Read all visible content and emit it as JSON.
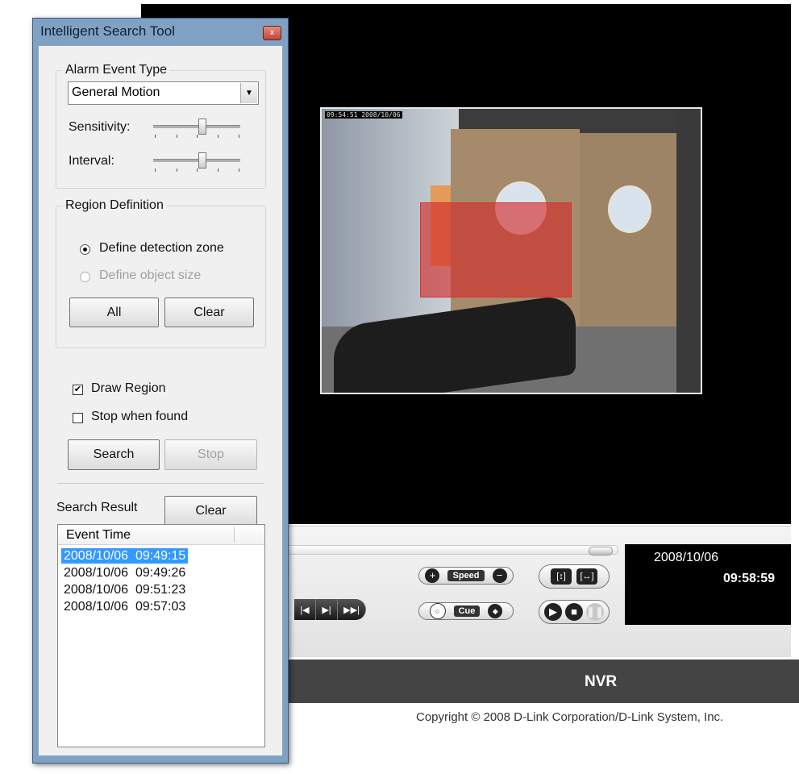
{
  "app": {
    "product_title": "NVR",
    "copyright": "Copyright © 2008 D-Link Corporation/D-Link System, Inc."
  },
  "video": {
    "timestamp": "09:54:51 2008/10/06"
  },
  "playback": {
    "speed_label": "Speed",
    "cue_label": "Cue",
    "date": "2008/10/06",
    "time": "09:58:59"
  },
  "dialog": {
    "title": "Intelligent Search Tool",
    "close_glyph": "x",
    "alarm_group": {
      "legend": "Alarm Event Type",
      "selected_type": "General Motion",
      "sensitivity_label": "Sensitivity:",
      "interval_label": "Interval:"
    },
    "region_group": {
      "legend": "Region Definition",
      "option_zone": "Define detection zone",
      "option_size": "Define object size",
      "all_label": "All",
      "clear_label": "Clear"
    },
    "draw_region_label": "Draw Region",
    "stop_when_found_label": "Stop when found",
    "draw_region_checked": true,
    "stop_when_found_checked": false,
    "search_label": "Search",
    "stop_label": "Stop",
    "result_label": "Search Result",
    "result_clear_label": "Clear",
    "results": {
      "column": "Event Time",
      "rows": [
        "2008/10/06  09:49:15",
        "2008/10/06  09:49:26",
        "2008/10/06  09:51:23",
        "2008/10/06  09:57:03"
      ]
    }
  }
}
